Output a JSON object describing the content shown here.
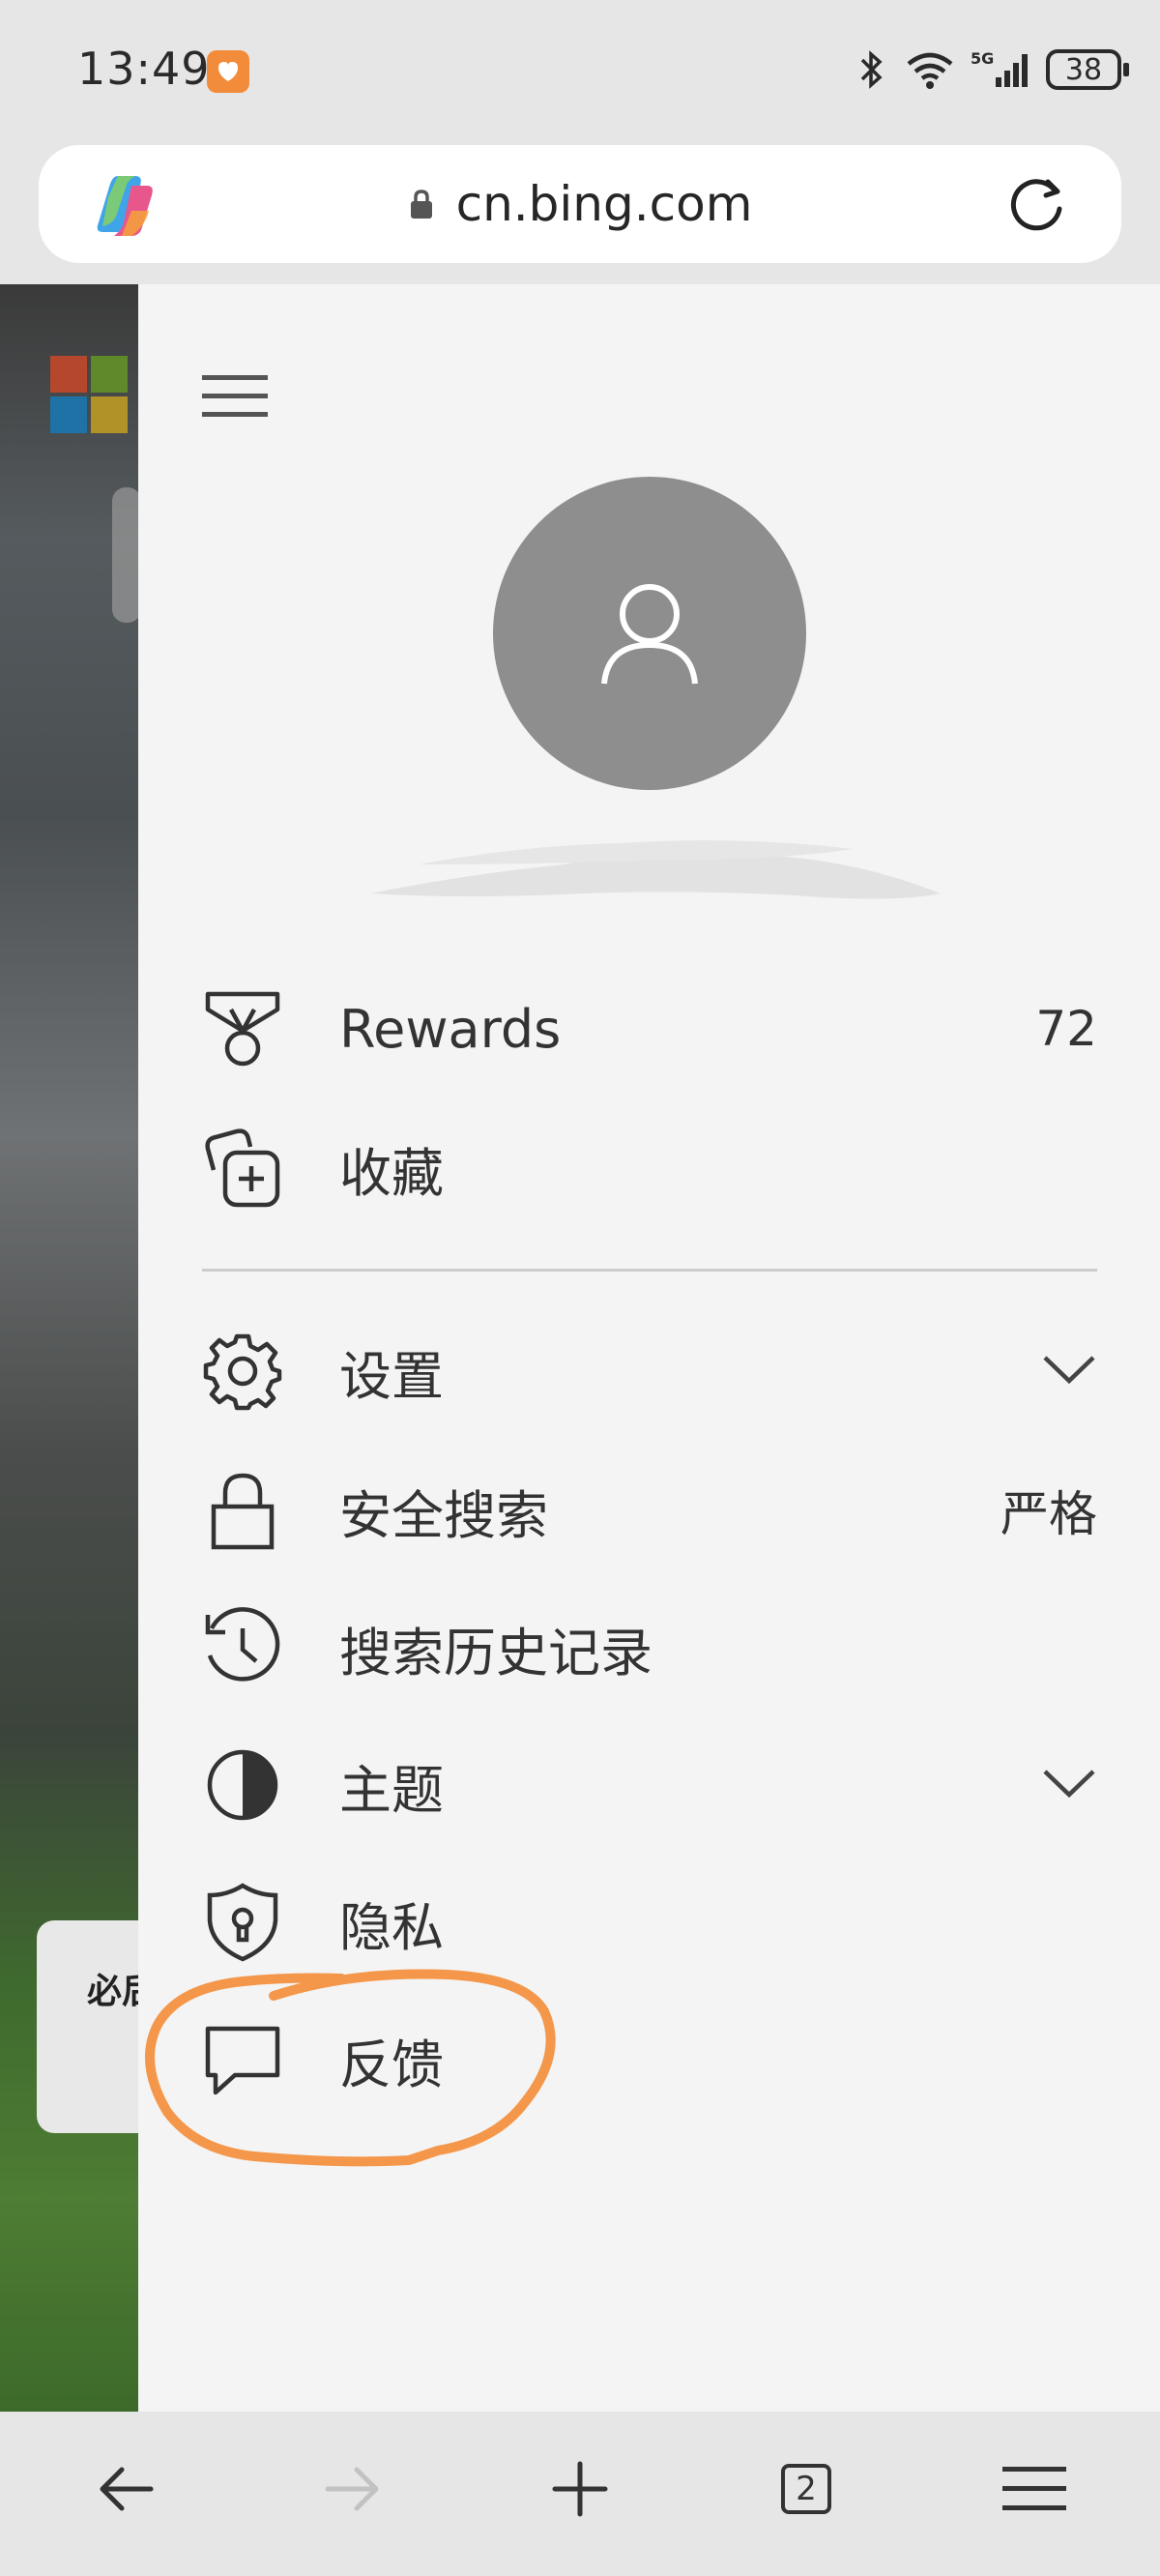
{
  "status_bar": {
    "time": "13:49",
    "battery": "38"
  },
  "address_bar": {
    "url": "cn.bing.com"
  },
  "drawer": {
    "menu": [
      {
        "id": "rewards",
        "label": "Rewards",
        "value": "72"
      },
      {
        "id": "favorites",
        "label": "收藏"
      },
      {
        "id": "settings",
        "label": "设置"
      },
      {
        "id": "safesearch",
        "label": "安全搜索",
        "value": "严格"
      },
      {
        "id": "history",
        "label": "搜索历史记录"
      },
      {
        "id": "theme",
        "label": "主题"
      },
      {
        "id": "privacy",
        "label": "隐私"
      },
      {
        "id": "feedback",
        "label": "反馈"
      }
    ]
  },
  "background_page": {
    "card_text": "必后"
  },
  "bottom_nav": {
    "tab_count": "2"
  },
  "colors": {
    "highlight": "#f4974a",
    "avatar": "#8e8e8e",
    "drawer_bg": "#f4f4f4"
  },
  "icons": [
    "copilot-icon",
    "lock-icon",
    "reload-icon",
    "hamburger-icon",
    "person-icon",
    "medal-icon",
    "add-collection-icon",
    "gear-icon",
    "padlock-icon",
    "history-icon",
    "theme-icon",
    "shield-icon",
    "chat-icon",
    "chevron-down-icon",
    "back-arrow-icon",
    "forward-arrow-icon",
    "plus-icon",
    "tabs-icon",
    "menu-icon"
  ]
}
